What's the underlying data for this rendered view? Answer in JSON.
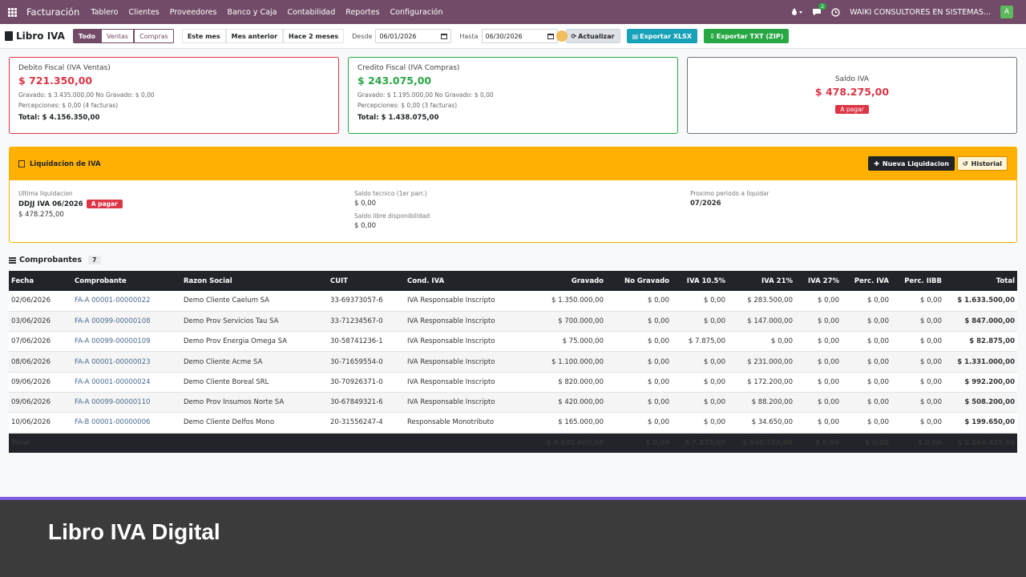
{
  "topbar": {
    "brand": "Facturación",
    "nav": [
      "Tablero",
      "Clientes",
      "Proveedores",
      "Banco y Caja",
      "Contabilidad",
      "Reportes",
      "Configuración"
    ],
    "messages_count": "2",
    "company": "WAIKI CONSULTORES EN SISTEMAS...",
    "avatar_letter": "A"
  },
  "controls": {
    "page_title": "Libro IVA",
    "scope": [
      "Todo",
      "Ventas",
      "Compras"
    ],
    "periods": [
      "Este mes",
      "Mes anterior",
      "Hace 2 meses"
    ],
    "desde_label": "Desde",
    "desde_value": "06/01/2026",
    "hasta_label": "Hasta",
    "hasta_value": "06/30/2026",
    "refresh_label": "Actualizar",
    "export_xlsx": "Exportar XLSX",
    "export_txt": "Exportar TXT (ZIP)"
  },
  "cards": {
    "debit": {
      "title": "Debito Fiscal (IVA Ventas)",
      "amount": "$ 721.350,00",
      "line1": "Gravado: $ 3.435.000,00   No Gravado: $ 0,00",
      "line2": "Percepciones: $ 0,00    (4 facturas)",
      "total": "Total: $ 4.156.350,00"
    },
    "credit": {
      "title": "Credito Fiscal (IVA Compras)",
      "amount": "$ 243.075,00",
      "line1": "Gravado: $ 1.195.000,00   No Gravado: $ 0,00",
      "line2": "Percepciones: $ 0,00    (3 facturas)",
      "total": "Total: $ 1.438.075,00"
    },
    "saldo": {
      "title": "Saldo IVA",
      "amount": "$ 478.275,00",
      "status": "A pagar"
    }
  },
  "liquidacion": {
    "title": "Liquidacion de IVA",
    "new_button": "Nueva Liquidacion",
    "history_button": "Historial",
    "ultima_label": "Ultima liquidacion",
    "ultima_value": "DDJJ IVA 06/2026",
    "ultima_status": "A pagar",
    "ultima_amount": "$ 478.275,00",
    "saldo_tecnico_label": "Saldo tecnico (1er parr.)",
    "saldo_tecnico_value": "$ 0,00",
    "saldo_libre_label": "Saldo libre disponibilidad",
    "saldo_libre_value": "$ 0,00",
    "proximo_label": "Proximo periodo a liquidar",
    "proximo_value": "07/2026"
  },
  "comprobantes": {
    "title": "Comprobantes",
    "count": "7",
    "columns": [
      "Fecha",
      "Comprobante",
      "Razon Social",
      "CUIT",
      "Cond. IVA",
      "Gravado",
      "No Gravado",
      "IVA 10.5%",
      "IVA 21%",
      "IVA 27%",
      "Perc. IVA",
      "Perc. IIBB",
      "Total"
    ],
    "rows": [
      [
        "02/06/2026",
        "FA-A 00001-00000022",
        "Demo Cliente Caelum SA",
        "33-69373057-6",
        "IVA Responsable Inscripto",
        "$ 1.350.000,00",
        "$ 0,00",
        "$ 0,00",
        "$ 283.500,00",
        "$ 0,00",
        "$ 0,00",
        "$ 0,00",
        "$ 1.633.500,00"
      ],
      [
        "03/06/2026",
        "FA-A 00099-00000108",
        "Demo Prov Servicios Tau SA",
        "33-71234567-0",
        "IVA Responsable Inscripto",
        "$ 700.000,00",
        "$ 0,00",
        "$ 0,00",
        "$ 147.000,00",
        "$ 0,00",
        "$ 0,00",
        "$ 0,00",
        "$ 847.000,00"
      ],
      [
        "07/06/2026",
        "FA-A 00099-00000109",
        "Demo Prov Energia Omega SA",
        "30-58741236-1",
        "IVA Responsable Inscripto",
        "$ 75.000,00",
        "$ 0,00",
        "$ 7.875,00",
        "$ 0,00",
        "$ 0,00",
        "$ 0,00",
        "$ 0,00",
        "$ 82.875,00"
      ],
      [
        "08/06/2026",
        "FA-A 00001-00000023",
        "Demo Cliente Acme SA",
        "30-71659554-0",
        "IVA Responsable Inscripto",
        "$ 1.100.000,00",
        "$ 0,00",
        "$ 0,00",
        "$ 231.000,00",
        "$ 0,00",
        "$ 0,00",
        "$ 0,00",
        "$ 1.331.000,00"
      ],
      [
        "09/06/2026",
        "FA-A 00001-00000024",
        "Demo Cliente Boreal SRL",
        "30-70926371-0",
        "IVA Responsable Inscripto",
        "$ 820.000,00",
        "$ 0,00",
        "$ 0,00",
        "$ 172.200,00",
        "$ 0,00",
        "$ 0,00",
        "$ 0,00",
        "$ 992.200,00"
      ],
      [
        "09/06/2026",
        "FA-A 00099-00000110",
        "Demo Prov Insumos Norte SA",
        "30-67849321-6",
        "IVA Responsable Inscripto",
        "$ 420.000,00",
        "$ 0,00",
        "$ 0,00",
        "$ 88.200,00",
        "$ 0,00",
        "$ 0,00",
        "$ 0,00",
        "$ 508.200,00"
      ],
      [
        "10/06/2026",
        "FA-B 00001-00000006",
        "Demo Cliente Delfos Mono",
        "20-31556247-4",
        "Responsable Monotributo",
        "$ 165.000,00",
        "$ 0,00",
        "$ 0,00",
        "$ 34.650,00",
        "$ 0,00",
        "$ 0,00",
        "$ 0,00",
        "$ 199.650,00"
      ]
    ],
    "totals": [
      "Total",
      "",
      "",
      "",
      "",
      "$ 4.630.000,00",
      "$ 0,00",
      "$ 7.875,00",
      "$ 956.550,00",
      "$ 0,00",
      "$ 0,00",
      "$ 0,00",
      "$ 5.594.425,00"
    ]
  },
  "banner": {
    "text": "Libro IVA Digital"
  },
  "colors": {
    "navbar": "#714b67",
    "debit": "#dc3545",
    "credit": "#28a745",
    "liquidacion_header": "#ffb000",
    "banner": "#3b3b3b",
    "banner_line": "#7c5ce0"
  }
}
